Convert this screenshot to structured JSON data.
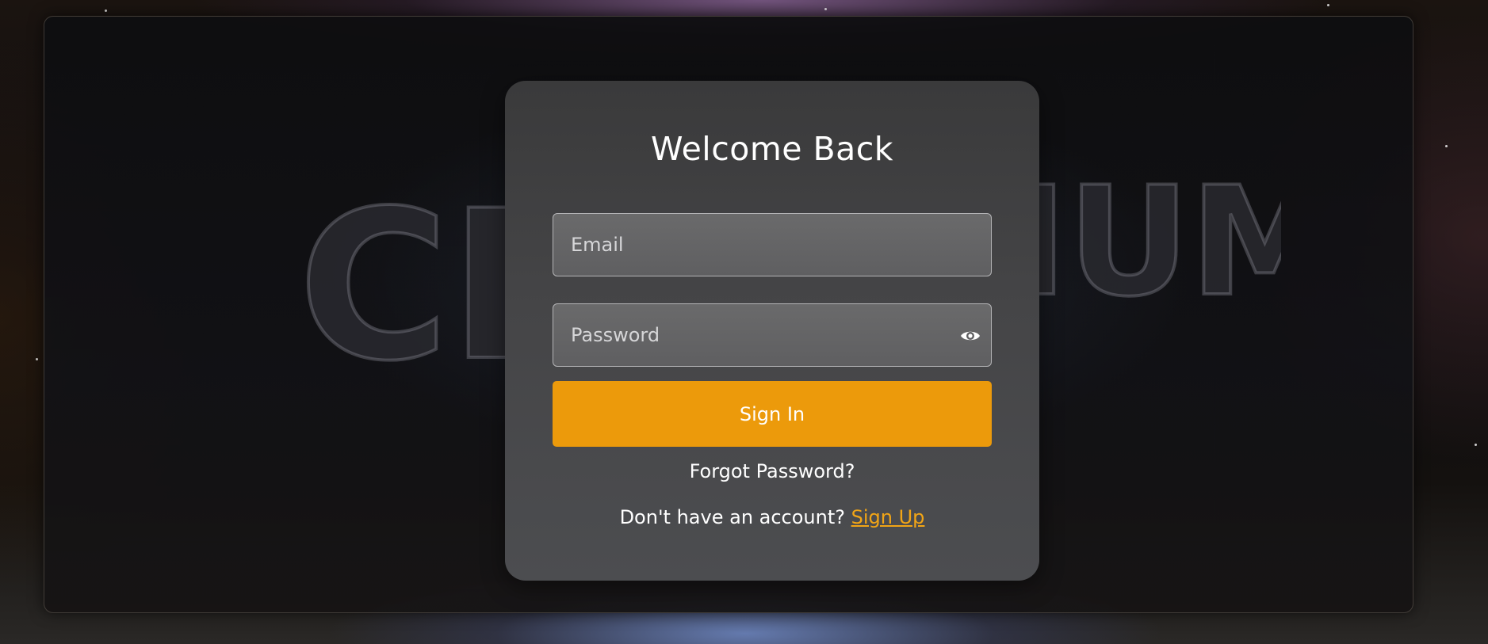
{
  "background": {
    "wordmark_left": "CH",
    "wordmark_right": "IUM"
  },
  "login": {
    "title": "Welcome Back",
    "email_placeholder": "Email",
    "password_placeholder": "Password",
    "show_password_icon": "eye-icon",
    "signin_label": "Sign In",
    "forgot_label": "Forgot Password?",
    "signup_prompt": "Don't have an account? ",
    "signup_label": "Sign Up"
  },
  "colors": {
    "accent": "#ec9a0b",
    "link": "#f2a516",
    "card": "#444446"
  }
}
